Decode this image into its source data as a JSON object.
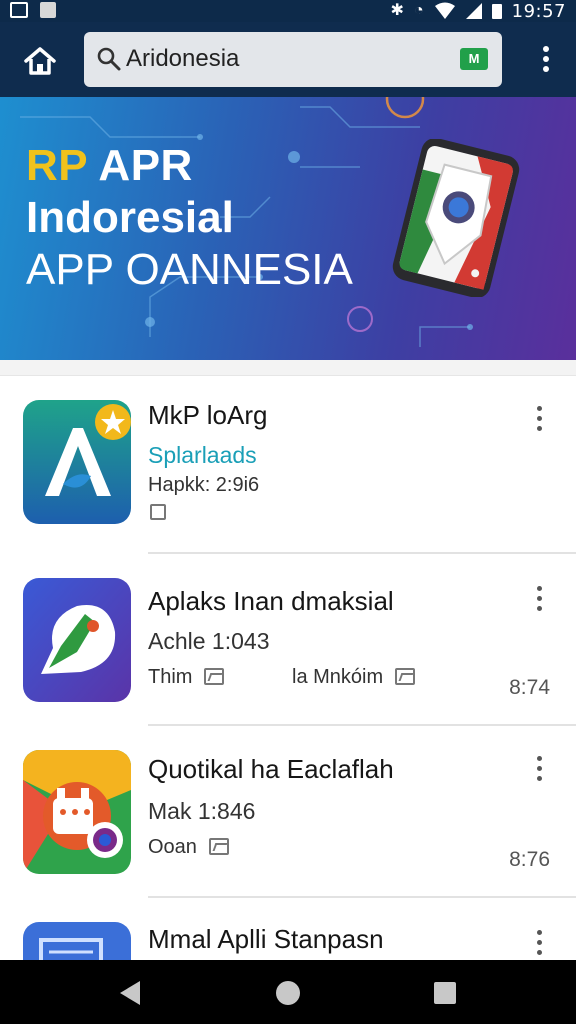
{
  "status_bar": {
    "time": "19:57",
    "icons": [
      "image-icon",
      "file-icon",
      "bluetooth-icon",
      "alarm-icon",
      "wifi-icon",
      "signal-icon",
      "battery-icon"
    ]
  },
  "app_bar": {
    "home_icon": "home-icon",
    "search": {
      "value": "Aridonesia",
      "badge": "M"
    },
    "menu_icon": "overflow-menu-icon"
  },
  "banner": {
    "line1_accent": "RP",
    "line1_rest": " APR",
    "line2": "Indoresial",
    "line3": "APP OANNESIA"
  },
  "apps": [
    {
      "title": "MkP loArg",
      "subtitle": "Splarlaads",
      "meta": "Hapkk: 2:9i6",
      "time": ""
    },
    {
      "title": "Aplaks Inan dmaksial",
      "subtitle": "Achle 1:043",
      "meta": "Thim",
      "meta2": "la Mnkóim",
      "time": "8:74"
    },
    {
      "title": "Quotikal ha Eaclaflah",
      "subtitle": "Mak 1:846",
      "meta": "Ooan",
      "time": "8:76"
    },
    {
      "title": "Mmal Aplli Stanpasn"
    }
  ],
  "colors": {
    "app_bar": "#0f2c4e",
    "banner_start": "#1e8fd0",
    "banner_end": "#5a2f9c",
    "accent_yellow": "#f0c21c",
    "teal_text": "#1a9fb7"
  }
}
